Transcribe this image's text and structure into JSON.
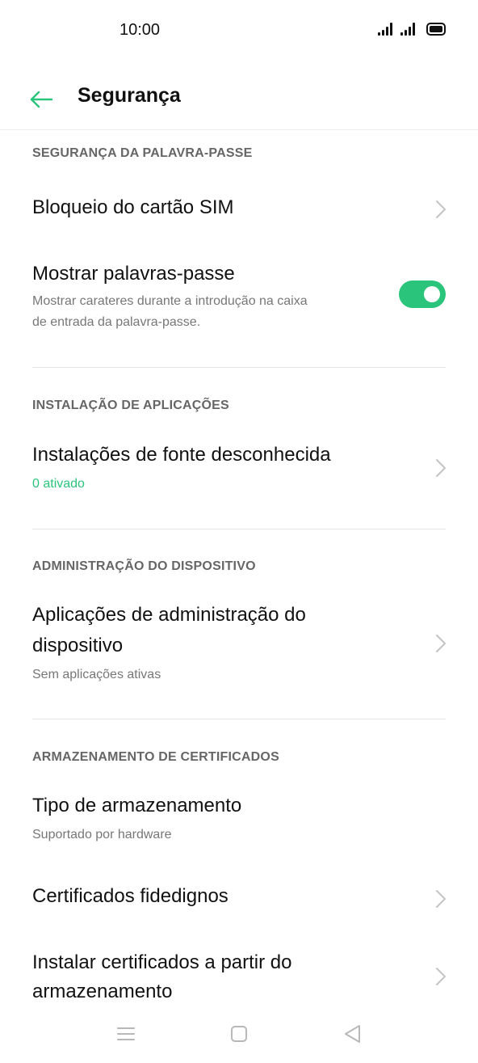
{
  "status_bar": {
    "time": "10:00"
  },
  "header": {
    "title": "Segurança",
    "back_icon": "arrow-left-icon",
    "accent_color": "#2bc47b"
  },
  "sections": {
    "password": {
      "header": "SEGURANÇA DA PALAVRA-PASSE",
      "sim_lock": {
        "title": "Bloqueio do cartão SIM"
      },
      "show_passwords": {
        "title": "Mostrar palavras-passe",
        "subtitle_line1": "Mostrar carateres durante a introdução na caixa",
        "subtitle_line2": "de entrada da palavra-passe.",
        "enabled": true
      }
    },
    "app_install": {
      "header": "INSTALAÇÃO DE APLICAÇÕES",
      "unknown_sources": {
        "title": "Instalações de fonte desconhecida",
        "subtitle": "0 ativado"
      }
    },
    "device_admin": {
      "header": "ADMINISTRAÇÃO DO DISPOSITIVO",
      "admin_apps": {
        "title_line1": "Aplicações de administração do",
        "title_line2": "dispositivo",
        "subtitle": "Sem aplicações ativas"
      }
    },
    "certificates": {
      "header": "ARMAZENAMENTO DE CERTIFICADOS",
      "storage_type": {
        "title": "Tipo de armazenamento",
        "subtitle": "Suportado por hardware"
      },
      "trusted": {
        "title": "Certificados fidedignos"
      },
      "install_from_storage": {
        "title_line1": "Instalar certificados a partir do",
        "title_line2": "armazenamento"
      }
    }
  },
  "nav_bar": {
    "menu_icon": "menu-icon",
    "home_icon": "home-square-icon",
    "back_icon": "back-triangle-icon"
  }
}
